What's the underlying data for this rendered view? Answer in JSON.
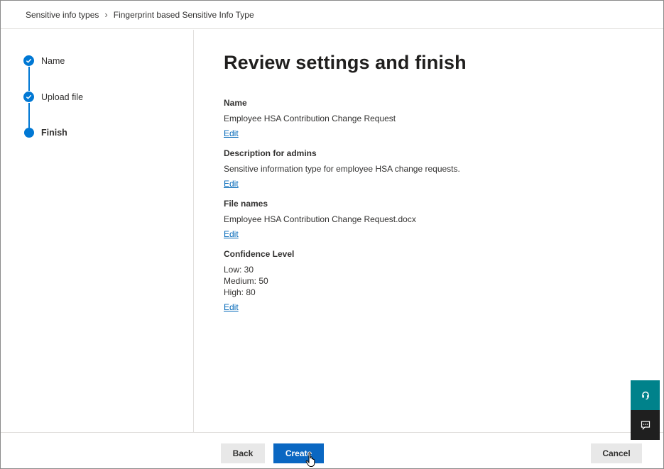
{
  "breadcrumb": {
    "root": "Sensitive info types",
    "current": "Fingerprint based Sensitive Info Type"
  },
  "steps": [
    {
      "label": "Name",
      "status": "complete"
    },
    {
      "label": "Upload file",
      "status": "complete"
    },
    {
      "label": "Finish",
      "status": "current"
    }
  ],
  "main": {
    "title": "Review settings and finish",
    "sections": [
      {
        "label": "Name",
        "values": [
          "Employee HSA Contribution Change Request"
        ],
        "edit": "Edit"
      },
      {
        "label": "Description for admins",
        "values": [
          "Sensitive information type for employee HSA change requests."
        ],
        "edit": "Edit"
      },
      {
        "label": "File names",
        "values": [
          "Employee HSA Contribution Change Request.docx"
        ],
        "edit": "Edit"
      },
      {
        "label": "Confidence Level",
        "values": [
          "Low: 30",
          "Medium: 50",
          "High: 80"
        ],
        "edit": "Edit"
      }
    ]
  },
  "footer": {
    "back": "Back",
    "create": "Create",
    "cancel": "Cancel"
  },
  "icons": {
    "chevron": "chevron-right-icon",
    "check": "checkmark-icon",
    "help": "headset-help-icon",
    "feedback": "feedback-icon"
  },
  "colors": {
    "accent": "#0078d4",
    "primary_button": "#0a67c2",
    "help_bg": "#00828b",
    "feedback_bg": "#1f1f1f",
    "link": "#0067b8"
  }
}
